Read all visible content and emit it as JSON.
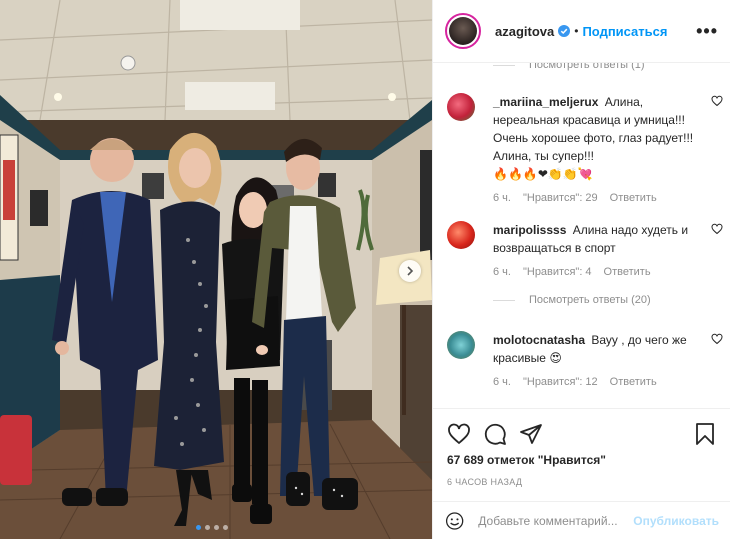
{
  "post": {
    "username": "azagitova",
    "separator": "•",
    "follow_label": "Подписаться",
    "more_label": "•••",
    "carousel": {
      "slides": 4,
      "active": 1
    }
  },
  "comments": {
    "top_replies": "Посмотреть ответы (1)",
    "items": [
      {
        "user": "_mariina_meljerux",
        "text": "Алина, нереальная красавица и умница!!! Очень хорошее фото, глаз радует!!! Алина, ты супер!!!",
        "emoji": "🔥🔥🔥❤👏👏💘",
        "time": "6 ч.",
        "likes": "\"Нравится\": 29",
        "reply": "Ответить"
      },
      {
        "user": "maripolissss",
        "text": "Алина надо худеть и возвращаться в спорт",
        "emoji": "",
        "time": "6 ч.",
        "likes": "\"Нравится\": 4",
        "reply": "Ответить",
        "replies": "Посмотреть ответы (20)"
      },
      {
        "user": "molotocnatasha",
        "text": "Вауу , до чего же красивые",
        "emoji": "😍",
        "time": "6 ч.",
        "likes": "\"Нравится\": 12",
        "reply": "Ответить"
      }
    ]
  },
  "footer": {
    "likes_count": "67 689",
    "likes_text": "отметок \"Нравится\"",
    "time_ago": "6 часов назад",
    "comment_placeholder": "Добавьте комментарий...",
    "publish_label": "Опубликовать"
  },
  "colors": {
    "link_blue": "#0095f6",
    "publish_disabled": "#b2dffc",
    "muted": "#8e8e8e",
    "text": "#262626"
  }
}
